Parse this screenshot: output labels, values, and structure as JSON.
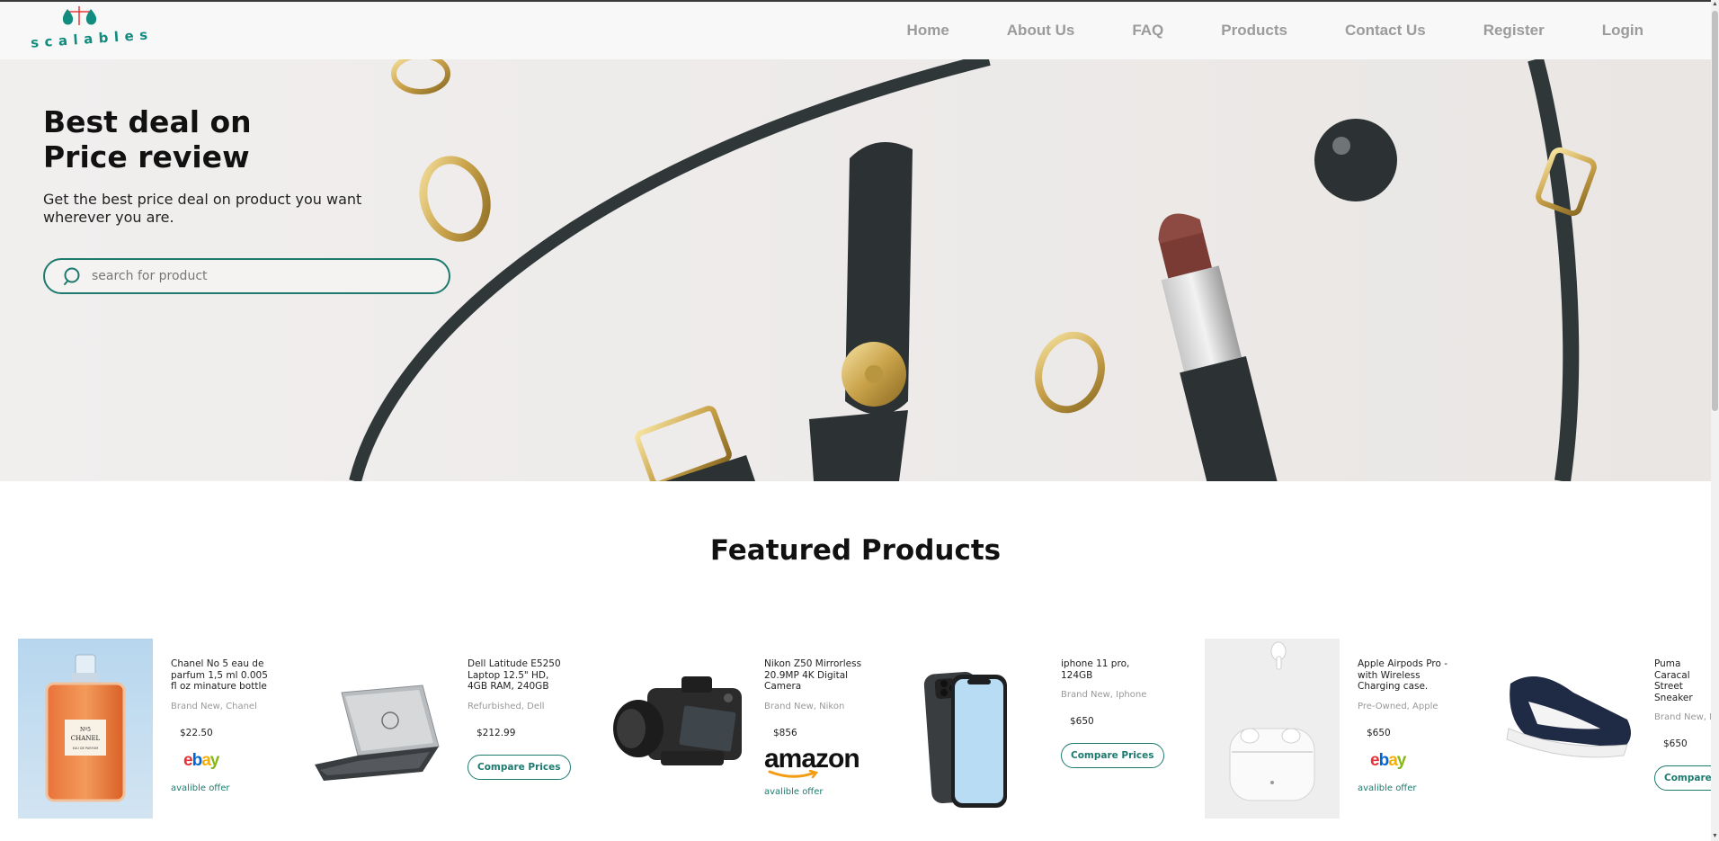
{
  "brand": {
    "name": "scalables",
    "accent": "#1d7a6e"
  },
  "nav": {
    "items": [
      "Home",
      "About Us",
      "FAQ",
      "Products",
      "Contact Us",
      "Register",
      "Login"
    ]
  },
  "hero": {
    "title_line1": "Best deal on",
    "title_line2": "Price review",
    "subtitle": "Get the best price deal on product you want wherever you are.",
    "search_placeholder": "search for product"
  },
  "featured": {
    "title": "Featured Products",
    "products": [
      {
        "name": "Chanel No 5 eau de parfum 1,5 ml 0.005 fl oz minature bottle",
        "condition": "Brand New, Chanel",
        "price": "$22.50",
        "store": "ebay",
        "action": "avalible offer",
        "image": "perfume-bottle"
      },
      {
        "name": "Dell Latitude E5250 Laptop 12.5\" HD, 4GB RAM, 240GB",
        "condition": "Refurbished, Dell",
        "price": "$212.99",
        "store": "",
        "action": "Compare Prices",
        "image": "laptop"
      },
      {
        "name": "Nikon Z50 Mirrorless 20.9MP 4K Digital Camera",
        "condition": "Brand New, Nikon",
        "price": "$856",
        "store": "amazon",
        "action": "avalible offer",
        "image": "camera"
      },
      {
        "name": "iphone 11 pro, 124GB",
        "condition": "Brand New, Iphone",
        "price": "$650",
        "store": "",
        "action": "Compare Prices",
        "image": "smartphone"
      },
      {
        "name": "Apple Airpods Pro -with Wireless Charging case.",
        "condition": "Pre-Owned, Apple",
        "price": "$650",
        "store": "ebay",
        "action": "avalible offer",
        "image": "earbuds"
      },
      {
        "name": "Puma Caracal Street Sneaker",
        "condition": "Brand New, Puma",
        "price": "$650",
        "store": "",
        "action": "Compare Prices",
        "image": "sneaker"
      }
    ]
  }
}
